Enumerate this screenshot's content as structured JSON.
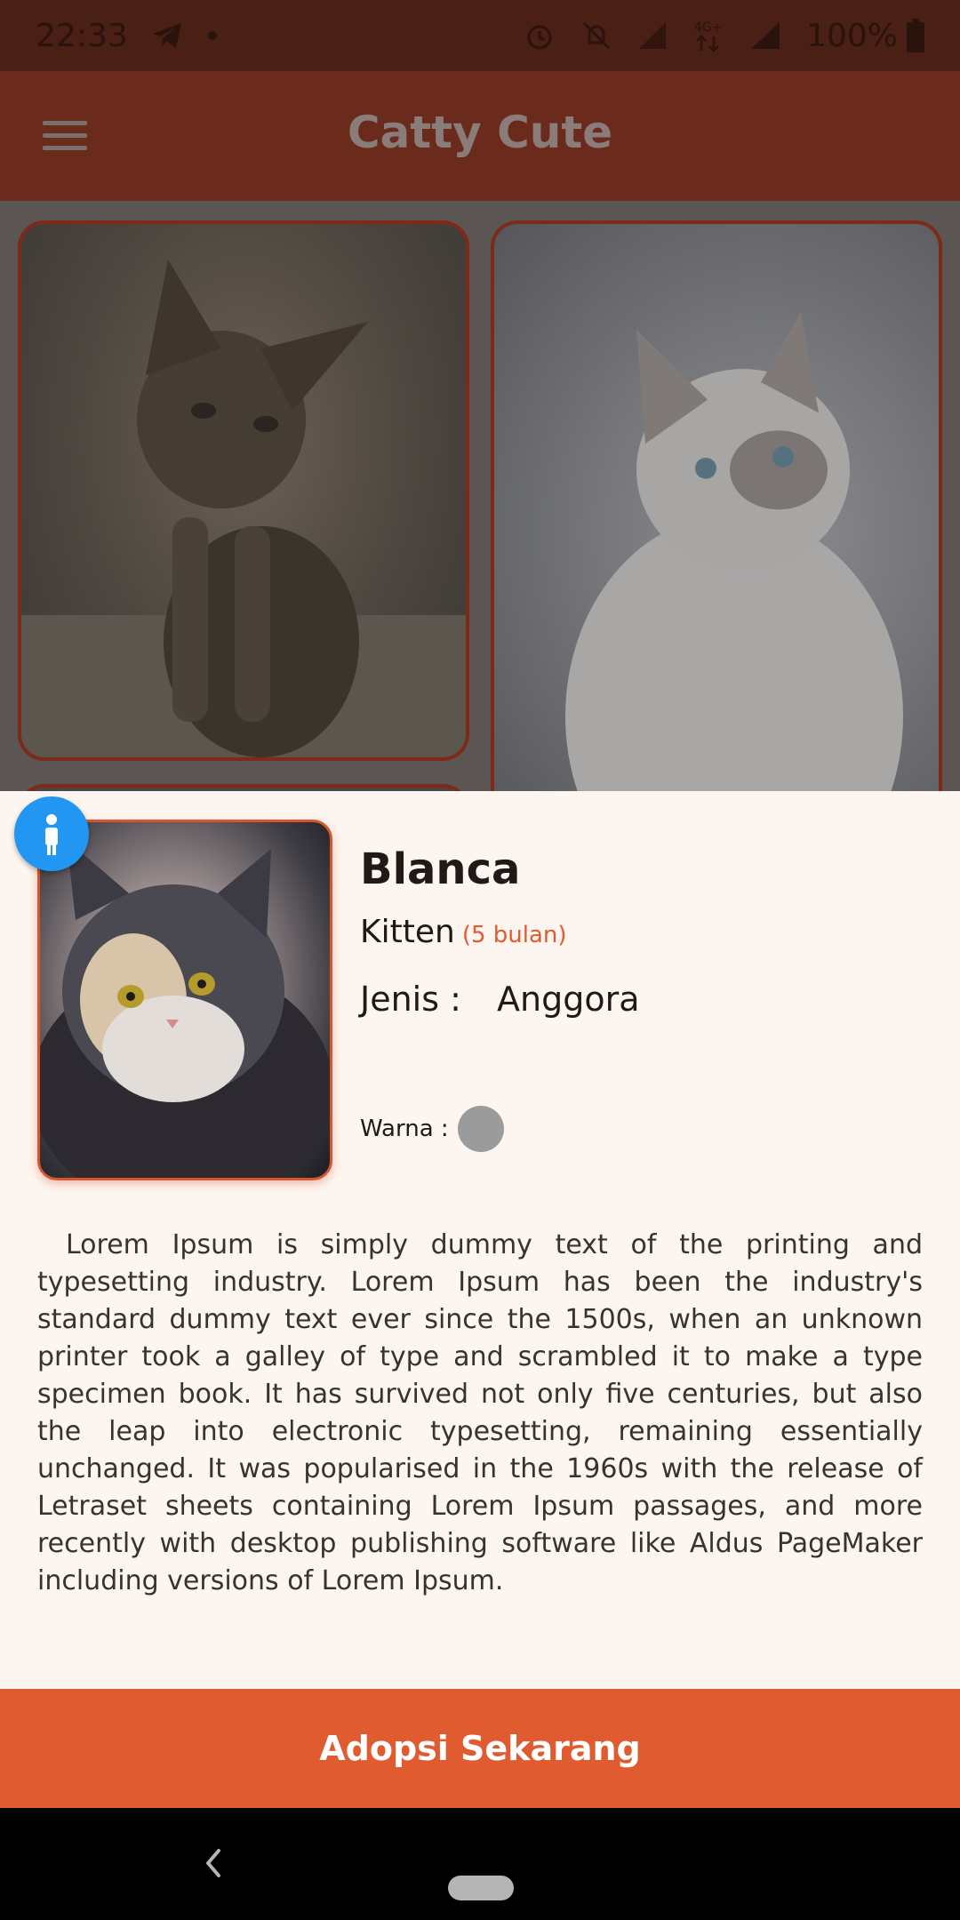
{
  "status_bar": {
    "time": "22:33",
    "battery": "100%",
    "icons": [
      "telegram-icon",
      "dot-icon",
      "alarm-icon",
      "mute-icon",
      "signal-icon",
      "4g-icon",
      "signal-full-icon",
      "battery-icon"
    ]
  },
  "app_bar": {
    "title": "Catty Cute",
    "menu_icon": "hamburger-menu-icon"
  },
  "detail": {
    "name": "Blanca",
    "age_category": "Kitten",
    "age_detail": "(5 bulan)",
    "breed_label": "Jenis :",
    "breed_value": "Anggora",
    "color_label": "Warna :",
    "color_value": "#9b9b9b",
    "description": "Lorem Ipsum is simply dummy text of the printing and typesetting industry. Lorem Ipsum has been the industry's standard dummy text ever since the 1500s, when an unknown printer took a galley of type and scrambled it to make a type specimen book. It has survived not only five centuries, but also the leap into electronic typesetting, remaining essentially unchanged. It was popularised in the 1960s with the release of Letraset sheets containing Lorem Ipsum passages, and more recently with desktop publishing software like Aldus PageMaker including versions of Lorem Ipsum."
  },
  "cta": {
    "label": "Adopsi Sekarang"
  },
  "colors": {
    "app_bar": "#6a2b1d",
    "accent": "#e05b30",
    "info_fab": "#2196f3",
    "sheet_bg": "#fdf5f0"
  }
}
